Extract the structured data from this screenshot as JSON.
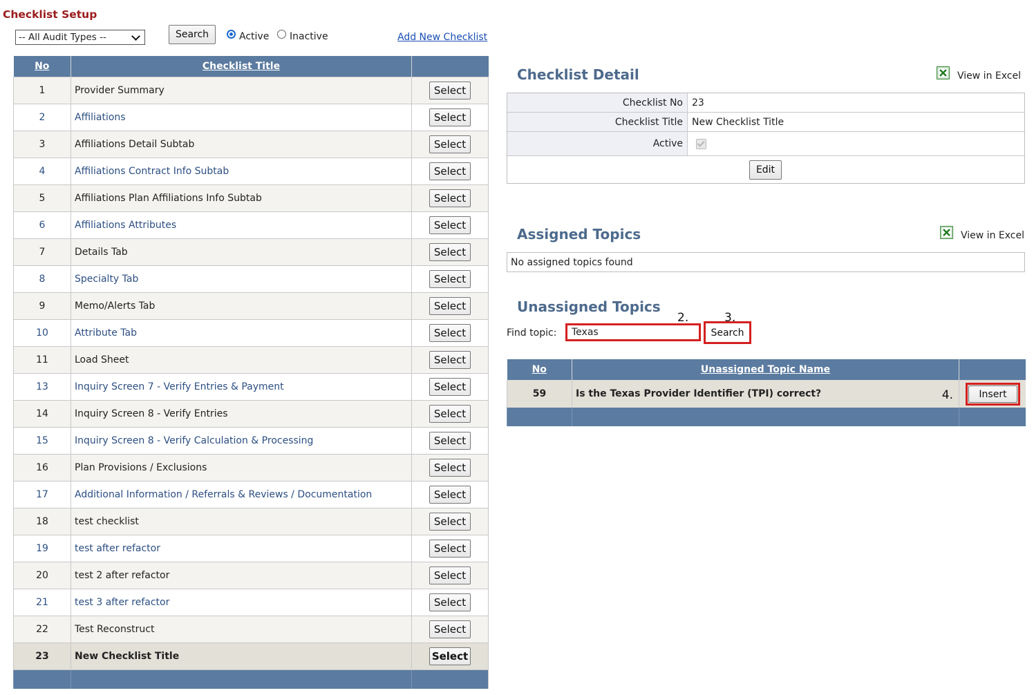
{
  "page": {
    "title": "Checklist Setup"
  },
  "filters": {
    "audit_type": "-- All Audit Types --",
    "search_label": "Search",
    "active_label": "Active",
    "inactive_label": "Inactive",
    "status_selected": "Active",
    "add_new_label": "Add New Checklist"
  },
  "checklist_table": {
    "headers": {
      "no": "No",
      "title": "Checklist Title"
    },
    "select_label": "Select",
    "selected_no": "23",
    "rows": [
      {
        "no": "1",
        "title": "Provider Summary"
      },
      {
        "no": "2",
        "title": "Affiliations"
      },
      {
        "no": "3",
        "title": "Affiliations Detail Subtab"
      },
      {
        "no": "4",
        "title": "Affiliations Contract Info Subtab"
      },
      {
        "no": "5",
        "title": "Affiliations Plan Affiliations Info Subtab"
      },
      {
        "no": "6",
        "title": "Affiliations Attributes"
      },
      {
        "no": "7",
        "title": "Details Tab"
      },
      {
        "no": "8",
        "title": "Specialty Tab"
      },
      {
        "no": "9",
        "title": "Memo/Alerts Tab"
      },
      {
        "no": "10",
        "title": "Attribute Tab"
      },
      {
        "no": "11",
        "title": "Load Sheet"
      },
      {
        "no": "13",
        "title": "Inquiry Screen 7 - Verify Entries & Payment"
      },
      {
        "no": "14",
        "title": "Inquiry Screen 8 - Verify Entries"
      },
      {
        "no": "15",
        "title": "Inquiry Screen 8 - Verify Calculation & Processing"
      },
      {
        "no": "16",
        "title": "Plan Provisions / Exclusions"
      },
      {
        "no": "17",
        "title": "Additional Information / Referrals & Reviews / Documentation"
      },
      {
        "no": "18",
        "title": "test checklist"
      },
      {
        "no": "19",
        "title": "test after refactor"
      },
      {
        "no": "20",
        "title": "test 2 after refactor"
      },
      {
        "no": "21",
        "title": "test 3 after refactor"
      },
      {
        "no": "22",
        "title": "Test Reconstruct"
      },
      {
        "no": "23",
        "title": "New Checklist Title"
      }
    ]
  },
  "checklist_detail": {
    "heading": "Checklist Detail",
    "view_excel_label": "View in Excel",
    "fields": {
      "no_label": "Checklist No",
      "no_value": "23",
      "title_label": "Checklist Title",
      "title_value": "New Checklist Title",
      "active_label": "Active",
      "active_checked": true
    },
    "edit_label": "Edit"
  },
  "assigned_topics": {
    "heading": "Assigned Topics",
    "view_excel_label": "View in Excel",
    "empty_message": "No assigned topics found"
  },
  "unassigned_topics": {
    "heading": "Unassigned Topics",
    "find_label": "Find topic:",
    "find_value": "Texas",
    "search_label": "Search",
    "headers": {
      "no": "No",
      "name": "Unassigned Topic Name"
    },
    "rows": [
      {
        "no": "59",
        "name": "Is the Texas Provider Identifier (TPI) correct?"
      }
    ],
    "insert_label": "Insert"
  },
  "annotations": {
    "step2": "2.",
    "step3": "3.",
    "step4": "4."
  },
  "colors": {
    "header_blue": "#5b7ba0",
    "title_red": "#9b1b1b",
    "highlight_red": "#d42020",
    "section_heading": "#4d6a8c"
  },
  "icons": {
    "excel": "excel-icon",
    "dropdown": "chevron-down-icon"
  }
}
